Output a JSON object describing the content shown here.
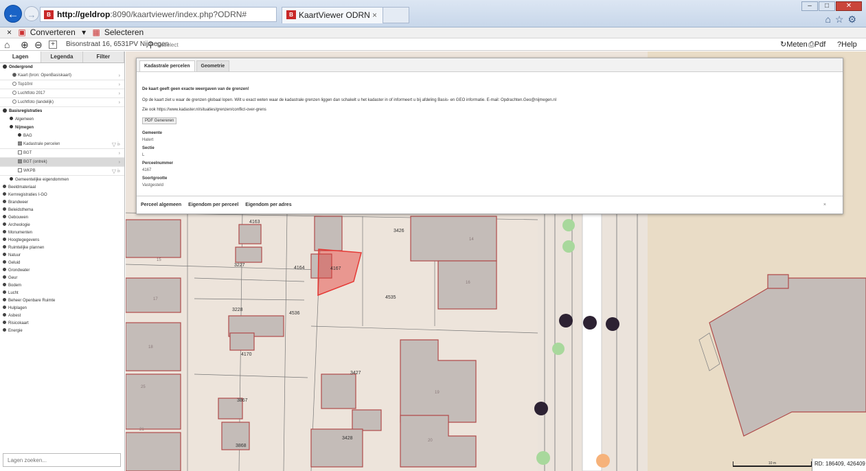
{
  "browser": {
    "url_host": "http://geldrop",
    "url_rest": ":8090/kaartviewer/index.php?ODRN#",
    "url_actions": "⚲ ▾ ↻",
    "favicon_text": "B",
    "tab_title": "KaartViewer ODRN",
    "tab_close": "×",
    "cmd_close": "×",
    "cmd_convert": "Converteren",
    "cmd_select": "Selecteren"
  },
  "toolbar": {
    "address": "Bisonstraat 16, 6531PV Nijmegen",
    "search_placeholder": "Geselect",
    "measure": "Meten",
    "pdf": "Pdf",
    "help": "Help"
  },
  "sidebar": {
    "tabs": [
      "Lagen",
      "Legenda",
      "Filter"
    ],
    "ondergrond": "Ondergrond",
    "basemaps": [
      "Kaart (bron: OpenBasiskaart)",
      "Top10nl",
      "Luchtfoto 2017",
      "Luchtfoto (landelijk)"
    ],
    "basisregistraties": "Basisregistraties",
    "algemeen": "Algemeen",
    "nijmegen": "Nijmegen",
    "bag": "BAG",
    "layers": [
      "Kadastrale percelen",
      "BGT",
      "BGT (ontrek)",
      "WKPB"
    ],
    "gemeentelijke": "Gemeentelijke eigendommen",
    "categories": [
      "Beeldmateriaal",
      "Kernregistraties I-GO",
      "Brandweer",
      "Beleidsthema",
      "Gebouwen",
      "Archeologie",
      "Monumenten",
      "Hoogtegegevens",
      "Ruimtelijke plannen",
      "Natuur",
      "Geluid",
      "Grondwater",
      "Geur",
      "Bodem",
      "Lucht",
      "Beheer Openbare Ruimte",
      "Hulplagen",
      "Asbest",
      "Risicokaart",
      "Energie"
    ],
    "layer_search_placeholder": "Lagen zoeken..."
  },
  "panel": {
    "tabs": [
      "Kadastrale percelen",
      "Geometrie"
    ],
    "warning": "De kaart geeft geen exacte weergaven van de grenzen!",
    "text1": "Op de kaart ziet u waar de grenzen globaal lopen. Wilt u exact weten waar de kadastrale grenzen liggen dan schakelt u het kadaster in of informeert u bij afdeling Basis- en GEO informatie. E-mail: Opdrachten.Geo@nijmegen.nl",
    "text2": "Zie ook https://www.kadaster.nl/situaties/grenzen/conflict-over-grens",
    "pdf_button": "PDF Genereren",
    "fields": [
      {
        "label": "Gemeente",
        "value": "Hatert"
      },
      {
        "label": "Sectie",
        "value": "L"
      },
      {
        "label": "Perceelnummer",
        "value": "4167"
      },
      {
        "label": "Soortgrootte",
        "value": "Vastgesteld"
      }
    ],
    "footer_tabs": [
      "Perceel algemeen",
      "Eigendom per perceel",
      "Eigendom per adres"
    ],
    "close": "×"
  },
  "map": {
    "parcel_numbers": [
      "4163",
      "3426",
      "3227",
      "4164",
      "4167",
      "4535",
      "3228",
      "4536",
      "4170",
      "3427",
      "3867",
      "3428",
      "3868"
    ],
    "house_numbers": [
      "14",
      "15",
      "16",
      "17",
      "18",
      "20",
      "21",
      "25",
      "19"
    ],
    "selected_color": "#e53935",
    "parcel_line_color": "#b04a4a",
    "scale_label": "10 m",
    "coords": "RD: 186409, 426409"
  }
}
